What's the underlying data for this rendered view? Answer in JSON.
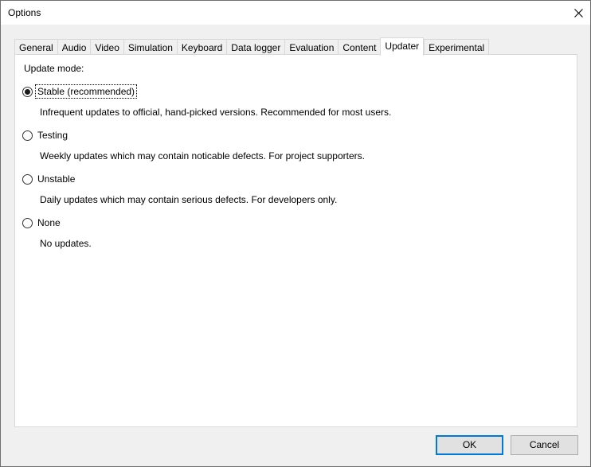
{
  "window": {
    "title": "Options"
  },
  "tabs": [
    {
      "label": "General"
    },
    {
      "label": "Audio"
    },
    {
      "label": "Video"
    },
    {
      "label": "Simulation"
    },
    {
      "label": "Keyboard"
    },
    {
      "label": "Data logger"
    },
    {
      "label": "Evaluation"
    },
    {
      "label": "Content"
    },
    {
      "label": "Updater",
      "active": true
    },
    {
      "label": "Experimental"
    }
  ],
  "updater": {
    "group_label": "Update mode:",
    "selected": "Stable (recommended)",
    "options": [
      {
        "label": "Stable (recommended)",
        "description": "Infrequent updates to official, hand-picked versions. Recommended for most users."
      },
      {
        "label": "Testing",
        "description": "Weekly updates which may contain noticable defects. For project supporters."
      },
      {
        "label": "Unstable",
        "description": "Daily updates which may contain serious defects. For developers only."
      },
      {
        "label": "None",
        "description": "No updates."
      }
    ]
  },
  "buttons": {
    "ok_label": "OK",
    "cancel_label": "Cancel"
  },
  "colors": {
    "focus_accent": "#0078d7"
  }
}
